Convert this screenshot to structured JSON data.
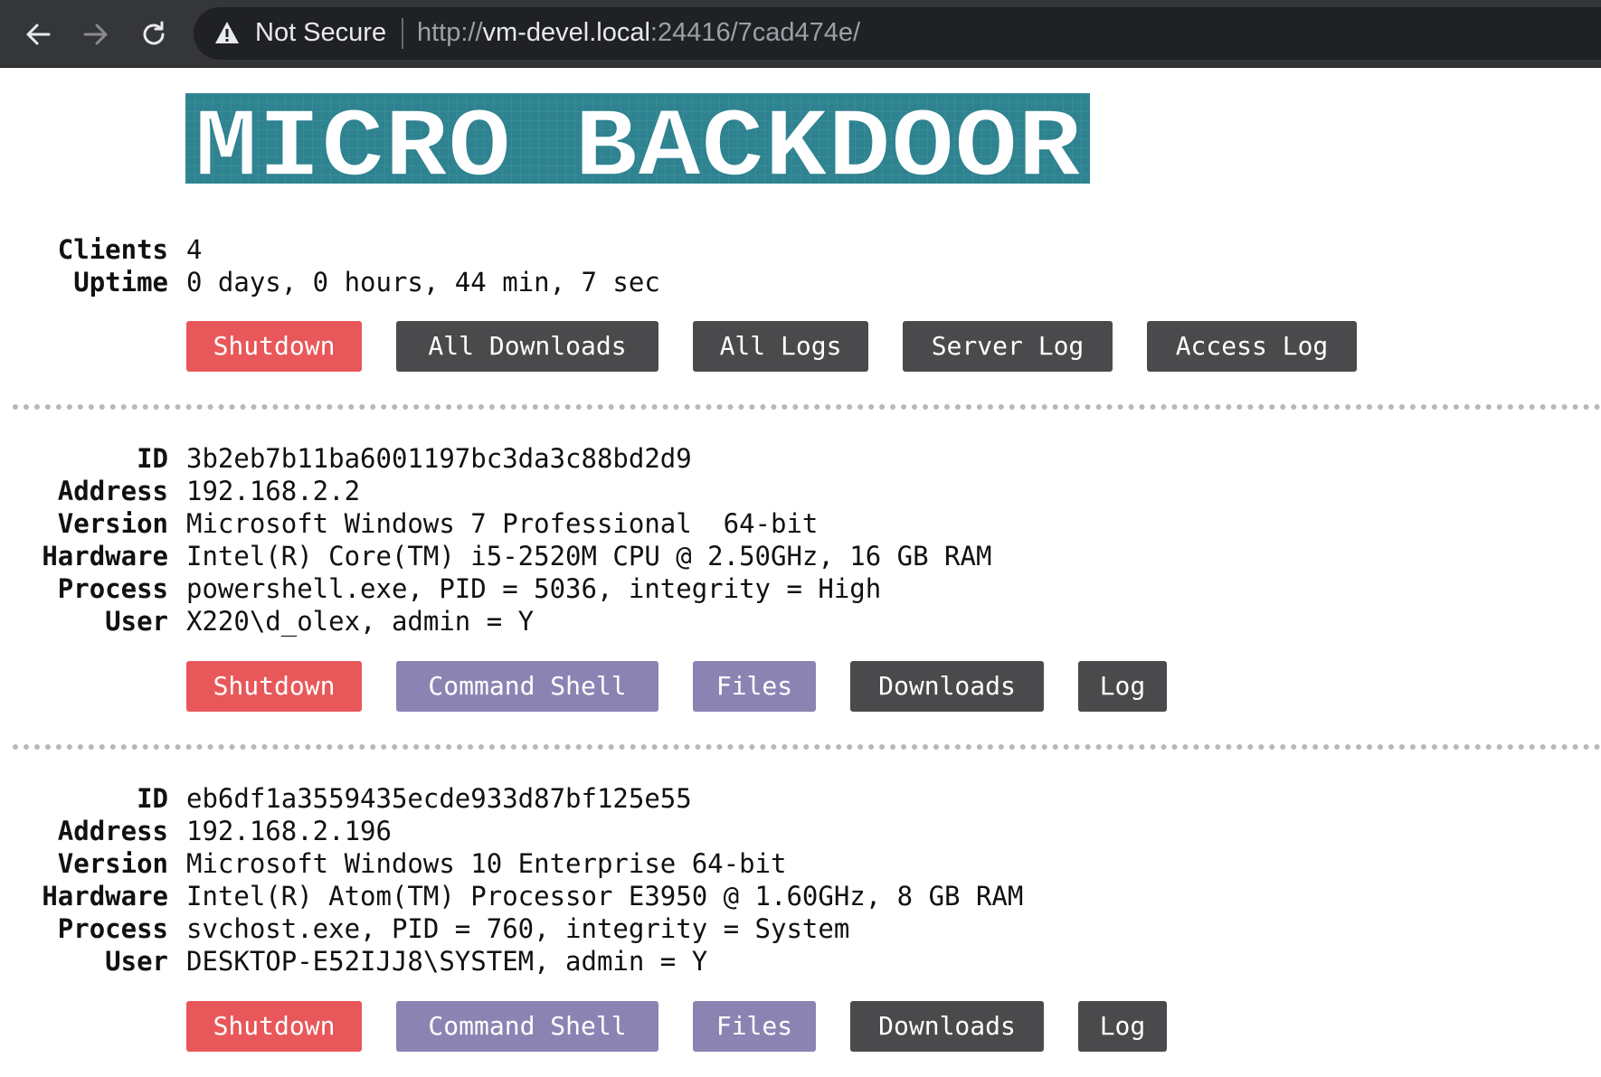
{
  "browser": {
    "security_text": "Not Secure",
    "url_scheme": "http://",
    "url_host": "vm-devel.local",
    "url_rest": ":24416/7cad474e/"
  },
  "logo": {
    "text": "MICRO BACKDOOR",
    "colors": {
      "background": "#2f8390",
      "text": "#ffffff"
    }
  },
  "server": {
    "clients_label": "Clients",
    "clients_value": "4",
    "uptime_label": "Uptime",
    "uptime_value": "0 days, 0 hours, 44 min, 7 sec",
    "buttons": {
      "shutdown": "Shutdown",
      "all_downloads": "All Downloads",
      "all_logs": "All Logs",
      "server_log": "Server Log",
      "access_log": "Access Log"
    }
  },
  "clients": [
    {
      "id_label": "ID",
      "id": "3b2eb7b11ba6001197bc3da3c88bd2d9",
      "address_label": "Address",
      "address": "192.168.2.2",
      "version_label": "Version",
      "version": "Microsoft Windows 7 Professional  64-bit",
      "hardware_label": "Hardware",
      "hardware": "Intel(R) Core(TM) i5-2520M CPU @ 2.50GHz, 16 GB RAM",
      "process_label": "Process",
      "process": "powershell.exe, PID = 5036, integrity = High",
      "user_label": "User",
      "user": "X220\\d_olex, admin = Y",
      "buttons": {
        "shutdown": "Shutdown",
        "shell": "Command Shell",
        "files": "Files",
        "downloads": "Downloads",
        "log": "Log"
      }
    },
    {
      "id_label": "ID",
      "id": "eb6df1a3559435ecde933d87bf125e55",
      "address_label": "Address",
      "address": "192.168.2.196",
      "version_label": "Version",
      "version": "Microsoft Windows 10 Enterprise 64-bit",
      "hardware_label": "Hardware",
      "hardware": "Intel(R) Atom(TM) Processor E3950 @ 1.60GHz, 8 GB RAM",
      "process_label": "Process",
      "process": "svchost.exe, PID = 760, integrity = System",
      "user_label": "User",
      "user": "DESKTOP-E52IJJ8\\SYSTEM, admin = Y",
      "buttons": {
        "shutdown": "Shutdown",
        "shell": "Command Shell",
        "files": "Files",
        "downloads": "Downloads",
        "log": "Log"
      }
    }
  ],
  "colors": {
    "shutdown": "#e8585a",
    "dark_button": "#4a4a4c",
    "purple_button": "#8b84b3",
    "divider": "#b8b8b8"
  }
}
